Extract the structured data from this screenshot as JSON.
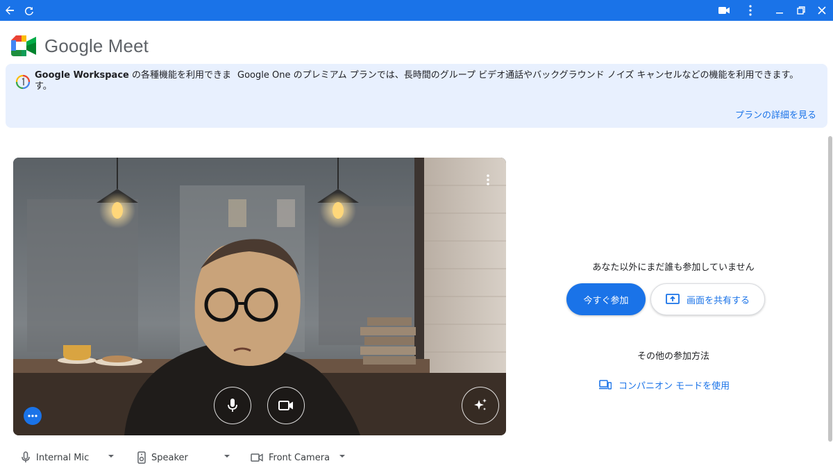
{
  "app": {
    "logo_text": "Google Meet"
  },
  "titlebar": {
    "icons": [
      "back-arrow-icon",
      "reload-icon",
      "video-camera-icon",
      "more-vert-icon",
      "minimize-icon",
      "restore-icon",
      "close-icon"
    ],
    "color": "#1a73e8"
  },
  "banner": {
    "workspace_brand": "Google Workspace",
    "workspace_text": " の各種機能を利用できます。",
    "one_text": "Google One のプレミアム プランでは、長時間のグループ ビデオ通話やバックグラウンド ノイズ キャンセルなどの機能を利用できます。",
    "details_link": "プランの詳細を見る",
    "background": "#e8f0fe"
  },
  "preview": {
    "controls": [
      "microphone-icon",
      "camera-icon",
      "visual-effects-icon",
      "more-options-icon",
      "three-dots-bubble-icon"
    ]
  },
  "join_panel": {
    "status": "あなた以外にまだ誰も参加していません",
    "join_button": "今すぐ参加",
    "share_button": "画面を共有する",
    "other_methods": "その他の参加方法",
    "companion_link": "コンパニオン モードを使用"
  },
  "devices": {
    "mic": "Internal Mic",
    "speaker": "Speaker",
    "camera": "Front Camera"
  },
  "colors": {
    "accent": "#1a73e8",
    "text": "#202124"
  }
}
